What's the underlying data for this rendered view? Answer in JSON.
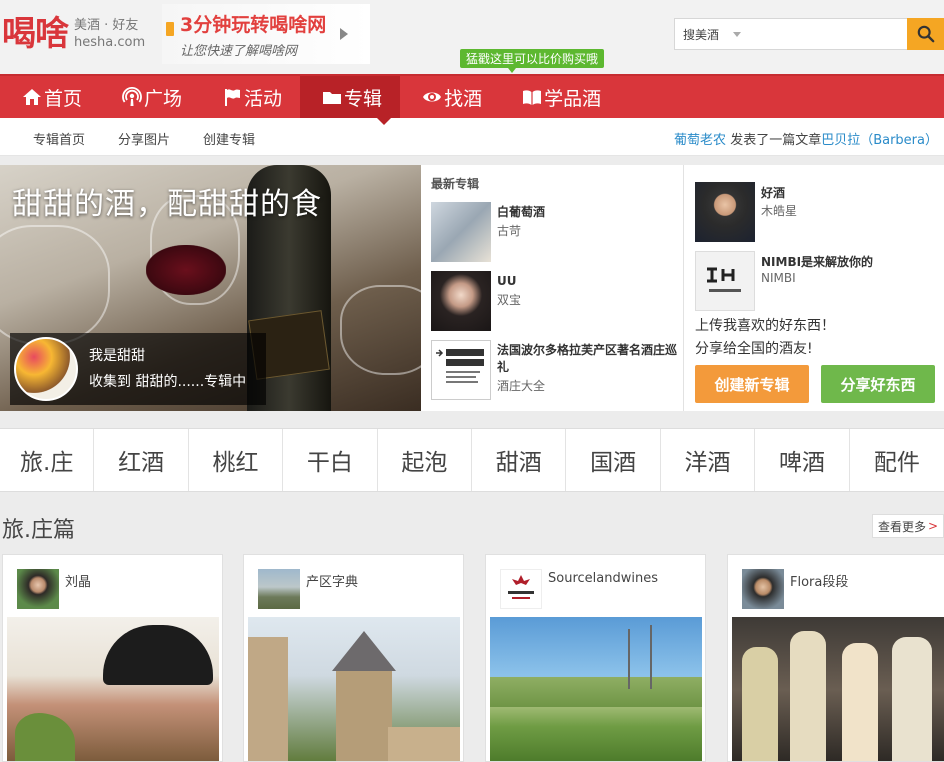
{
  "brand": {
    "logo_glyph": "喝啥",
    "tagline": "美酒 · 好友",
    "domain": "hesha.com"
  },
  "promo": {
    "title": "3分钟玩转喝啥网",
    "subtitle": "让您快速了解喝啥网"
  },
  "tip": "猛戳这里可以比价购买哦",
  "search": {
    "scope": "搜美酒",
    "placeholder": ""
  },
  "nav": {
    "items": [
      {
        "label": "首页",
        "icon": "home-icon"
      },
      {
        "label": "广场",
        "icon": "podcast-icon"
      },
      {
        "label": "活动",
        "icon": "flag-icon"
      },
      {
        "label": "专辑",
        "icon": "folder-icon"
      },
      {
        "label": "找酒",
        "icon": "eye-icon"
      },
      {
        "label": "学品酒",
        "icon": "book-icon"
      }
    ],
    "active": "专辑"
  },
  "subnav": {
    "items": [
      "专辑首页",
      "分享图片",
      "创建专辑"
    ]
  },
  "activity": {
    "user": "葡萄老农",
    "action": " 发表了一篇文章",
    "target": "巴贝拉（Barbera）"
  },
  "hero": {
    "title": "甜甜的酒，配甜甜的食",
    "user_text": "我是甜甜",
    "collect_text": "收集到  甜甜的......专辑中"
  },
  "latest": {
    "heading": "最新专辑",
    "albums": [
      {
        "name": "白葡萄酒",
        "author": "古苛"
      },
      {
        "name": "UU",
        "author": "双宝"
      },
      {
        "name": "法国波尔多格拉芙产区著名酒庄巡礼",
        "author": "酒庄大全"
      }
    ]
  },
  "right": {
    "users": [
      {
        "name": "好酒",
        "sub": "木皓星"
      },
      {
        "name": "NIMBI是来解放你的",
        "sub": "NIMBI"
      }
    ],
    "upload_line1": "上传我喜欢的好东西！",
    "upload_line2": "分享给全国的酒友!",
    "create_label": "创建新专辑",
    "share_label": "分享好东西"
  },
  "categories": [
    "旅.庄",
    "红酒",
    "桃红",
    "干白",
    "起泡",
    "甜酒",
    "国酒",
    "洋酒",
    "啤酒",
    "配件"
  ],
  "section": {
    "title": "旅.庄篇",
    "more": "查看更多",
    "more_arrow": ">",
    "cards": [
      {
        "user": "刘晶"
      },
      {
        "user": "产区字典"
      },
      {
        "user": "Sourcelandwines"
      },
      {
        "user": "Flora段段"
      }
    ]
  },
  "colors": {
    "brand_red": "#d9363b",
    "orange": "#f39a3b",
    "green": "#6fb84b",
    "link_blue": "#2a8bc9"
  }
}
